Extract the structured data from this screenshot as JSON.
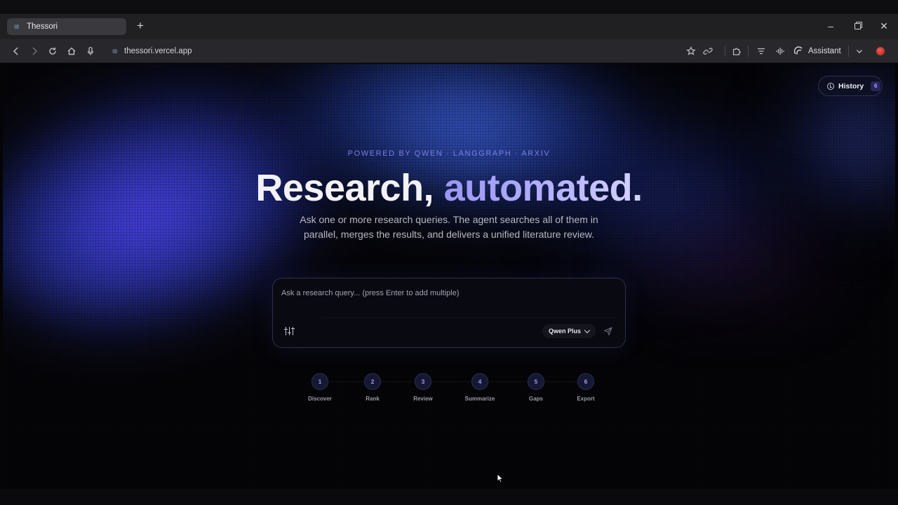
{
  "browser": {
    "tab_title": "Thessori",
    "new_tab_label": "+",
    "url": "thessori.vercel.app",
    "assistant_label": "Assistant",
    "icons": {
      "back": "chevron-left-icon",
      "forward": "chevron-right-icon",
      "reload": "reload-icon",
      "home": "home-icon",
      "mic": "microphone-icon",
      "bookmark": "star-icon",
      "share": "link-icon",
      "extensions": "puzzle-icon",
      "menu": "menu-icon",
      "audio": "waveform-icon"
    }
  },
  "page": {
    "history": {
      "label": "History",
      "count": "6"
    },
    "eyebrow": "POWERED BY QWEN · LANGGRAPH · ARXIV",
    "hero": {
      "part1": "Research, ",
      "part2": "automated."
    },
    "subtitle": "Ask one or more research queries. The agent searches all of them in parallel, merges the results, and delivers a unified literature review.",
    "composer": {
      "placeholder": "Ask a research query... (press Enter to add multiple)",
      "value": "",
      "model": "Qwen Plus"
    },
    "steps": [
      {
        "num": "1",
        "label": "Discover"
      },
      {
        "num": "2",
        "label": "Rank"
      },
      {
        "num": "3",
        "label": "Review"
      },
      {
        "num": "4",
        "label": "Summarize"
      },
      {
        "num": "5",
        "label": "Gaps"
      },
      {
        "num": "6",
        "label": "Export"
      }
    ]
  },
  "colors": {
    "accent": "#9a96f0",
    "eyebrow": "#7c7fe0",
    "background": "#050508",
    "glow_blue": "#4a46ff"
  }
}
